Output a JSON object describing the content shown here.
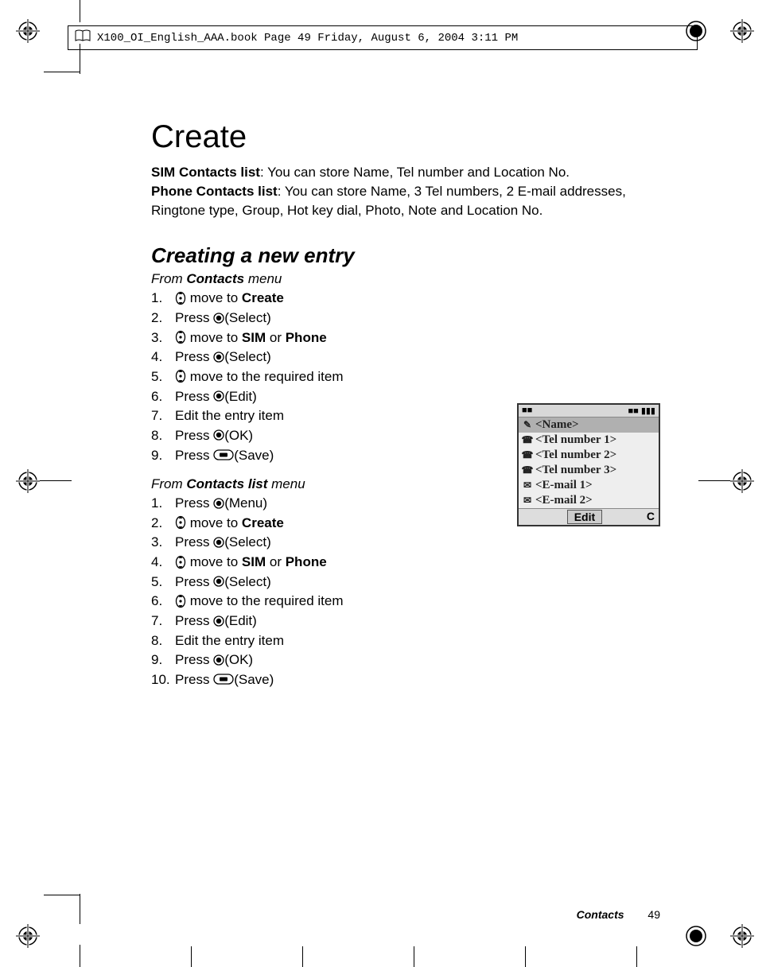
{
  "header": {
    "text": "X100_OI_English_AAA.book  Page 49  Friday, August 6, 2004  3:11 PM"
  },
  "title": "Create",
  "intro": {
    "sim_label": "SIM Contacts list",
    "sim_text": ": You can store Name, Tel number and Location No.",
    "phone_label": "Phone Contacts list",
    "phone_text": ": You can store Name, 3 Tel numbers, 2 E-mail addresses, Ringtone type, Group, Hot key dial, Photo, Note and Location No."
  },
  "subhead": "Creating a new entry",
  "section1": {
    "from_prefix": "From ",
    "from_bold": "Contacts",
    "from_suffix": " menu",
    "steps": [
      {
        "n": "1.",
        "pre": "",
        "icon": "nav",
        "post": " move to ",
        "bold": "Create",
        "tail": ""
      },
      {
        "n": "2.",
        "pre": "Press ",
        "icon": "center",
        "post": "(Select)",
        "bold": "",
        "tail": ""
      },
      {
        "n": "3.",
        "pre": "",
        "icon": "nav",
        "post": " move to ",
        "bold": "SIM",
        "tail": " or ",
        "bold2": "Phone"
      },
      {
        "n": "4.",
        "pre": "Press ",
        "icon": "center",
        "post": "(Select)",
        "bold": "",
        "tail": ""
      },
      {
        "n": "5.",
        "pre": "",
        "icon": "nav",
        "post": " move to the required item",
        "bold": "",
        "tail": ""
      },
      {
        "n": "6.",
        "pre": "Press ",
        "icon": "center",
        "post": "(Edit)",
        "bold": "",
        "tail": ""
      },
      {
        "n": "7.",
        "pre": "Edit the entry item",
        "icon": "",
        "post": "",
        "bold": "",
        "tail": ""
      },
      {
        "n": "8.",
        "pre": "Press ",
        "icon": "center",
        "post": "(OK)",
        "bold": "",
        "tail": ""
      },
      {
        "n": "9.",
        "pre": "Press ",
        "icon": "side",
        "post": "(Save)",
        "bold": "",
        "tail": ""
      }
    ]
  },
  "section2": {
    "from_prefix": "From ",
    "from_bold": "Contacts list",
    "from_suffix": " menu",
    "steps": [
      {
        "n": "1.",
        "pre": "Press ",
        "icon": "center",
        "post": "(Menu)",
        "bold": "",
        "tail": ""
      },
      {
        "n": "2.",
        "pre": "",
        "icon": "nav",
        "post": " move to ",
        "bold": "Create",
        "tail": ""
      },
      {
        "n": "3.",
        "pre": "Press ",
        "icon": "center",
        "post": "(Select)",
        "bold": "",
        "tail": ""
      },
      {
        "n": "4.",
        "pre": "",
        "icon": "nav",
        "post": " move to ",
        "bold": "SIM",
        "tail": " or ",
        "bold2": "Phone"
      },
      {
        "n": "5.",
        "pre": "Press ",
        "icon": "center",
        "post": "(Select)",
        "bold": "",
        "tail": ""
      },
      {
        "n": "6.",
        "pre": "",
        "icon": "nav",
        "post": " move to the required item",
        "bold": "",
        "tail": ""
      },
      {
        "n": "7.",
        "pre": "Press ",
        "icon": "center",
        "post": "(Edit)",
        "bold": "",
        "tail": ""
      },
      {
        "n": "8.",
        "pre": "Edit the entry item",
        "icon": "",
        "post": "",
        "bold": "",
        "tail": ""
      },
      {
        "n": "9.",
        "pre": "Press ",
        "icon": "center",
        "post": "(OK)",
        "bold": "",
        "tail": ""
      },
      {
        "n": "10.",
        "pre": "Press ",
        "icon": "side",
        "post": "(Save)",
        "bold": "",
        "tail": ""
      }
    ]
  },
  "screenshot": {
    "top_left": "■■",
    "top_right": "■■ ▮▮▮",
    "rows": [
      {
        "icon": "✎",
        "text": "<Name>",
        "sel": true
      },
      {
        "icon": "☎",
        "text": "<Tel number 1>"
      },
      {
        "icon": "☎",
        "text": "<Tel number 2>"
      },
      {
        "icon": "☎",
        "text": "<Tel number 3>"
      },
      {
        "icon": "✉",
        "text": "<E-mail 1>"
      },
      {
        "icon": "✉",
        "text": "<E-mail 2>"
      }
    ],
    "bottom_left": "",
    "bottom_mid": "Edit",
    "bottom_right": "C"
  },
  "footer": {
    "section": "Contacts",
    "page": "49"
  }
}
